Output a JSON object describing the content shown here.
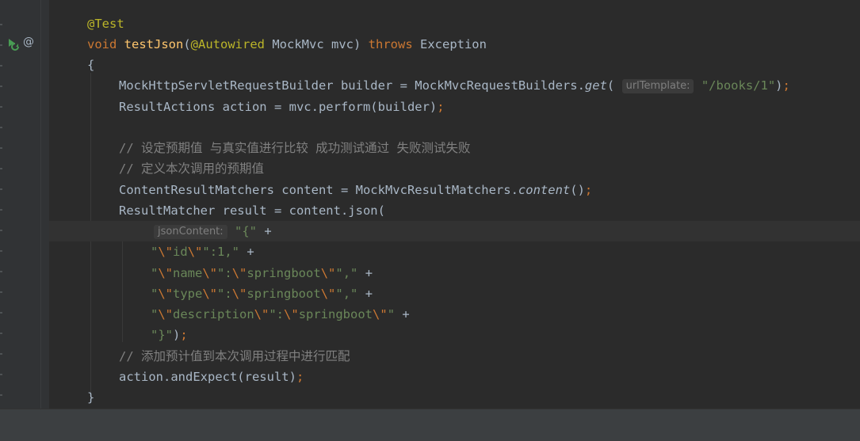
{
  "editor": {
    "code_lines": [
      {
        "id": "l1",
        "parts": [
          {
            "t": "@Test",
            "c": "ann"
          }
        ]
      },
      {
        "id": "l2",
        "parts": [
          {
            "t": "void ",
            "c": "kw"
          },
          {
            "t": "testJson",
            "c": "fn"
          },
          {
            "t": "(",
            "c": ""
          },
          {
            "t": "@Autowired",
            "c": "ann"
          },
          {
            "t": " MockMvc mvc) ",
            "c": ""
          },
          {
            "t": "throws",
            "c": "kw"
          },
          {
            "t": " Exception",
            "c": ""
          }
        ]
      },
      {
        "id": "l3",
        "parts": [
          {
            "t": "{",
            "c": ""
          }
        ]
      },
      {
        "id": "l4",
        "parts": [
          {
            "t": "MockHttpServletRequestBuilder builder = MockMvcRequestBuilders.",
            "c": ""
          },
          {
            "t": "get",
            "c": "it"
          },
          {
            "t": "( ",
            "c": ""
          },
          {
            "t": "urlTemplate:",
            "c": "hint"
          },
          {
            "t": " ",
            "c": ""
          },
          {
            "t": "\"/books/1\"",
            "c": "str"
          },
          {
            "t": ")",
            "c": ""
          },
          {
            "t": ";",
            "c": "kw"
          }
        ]
      },
      {
        "id": "l5",
        "parts": [
          {
            "t": "ResultActions action = mvc.perform(builder)",
            "c": ""
          },
          {
            "t": ";",
            "c": "kw"
          }
        ]
      },
      {
        "id": "l6",
        "parts": []
      },
      {
        "id": "l7",
        "parts": [
          {
            "t": "// 设定预期值 与真实值进行比较 成功测试通过 失败测试失败",
            "c": "cmt"
          }
        ]
      },
      {
        "id": "l8",
        "parts": [
          {
            "t": "// 定义本次调用的预期值",
            "c": "cmt"
          }
        ]
      },
      {
        "id": "l9",
        "parts": [
          {
            "t": "ContentResultMatchers content = MockMvcResultMatchers.",
            "c": ""
          },
          {
            "t": "content",
            "c": "it"
          },
          {
            "t": "()",
            "c": ""
          },
          {
            "t": ";",
            "c": "kw"
          }
        ]
      },
      {
        "id": "l10",
        "parts": [
          {
            "t": "ResultMatcher result = content.json(",
            "c": ""
          }
        ]
      },
      {
        "id": "l11",
        "parts": [
          {
            "t": "jsonContent:",
            "c": "hint"
          },
          {
            "t": " ",
            "c": ""
          },
          {
            "t": "\"{\"",
            "c": "str"
          },
          {
            "t": " +",
            "c": ""
          }
        ]
      },
      {
        "id": "l12",
        "parts": [
          {
            "t": "\"",
            "c": "str"
          },
          {
            "t": "\\\"",
            "c": "esc"
          },
          {
            "t": "id",
            "c": "str"
          },
          {
            "t": "\\\"",
            "c": "esc"
          },
          {
            "t": "\":1,\"",
            "c": "str"
          },
          {
            "t": " +",
            "c": ""
          }
        ]
      },
      {
        "id": "l13",
        "parts": [
          {
            "t": "\"",
            "c": "str"
          },
          {
            "t": "\\\"",
            "c": "esc"
          },
          {
            "t": "name",
            "c": "str"
          },
          {
            "t": "\\\"",
            "c": "esc"
          },
          {
            "t": "\":",
            "c": "str"
          },
          {
            "t": "\\\"",
            "c": "esc"
          },
          {
            "t": "springboot",
            "c": "str"
          },
          {
            "t": "\\\"",
            "c": "esc"
          },
          {
            "t": "\",\"",
            "c": "str"
          },
          {
            "t": " +",
            "c": ""
          }
        ]
      },
      {
        "id": "l14",
        "parts": [
          {
            "t": "\"",
            "c": "str"
          },
          {
            "t": "\\\"",
            "c": "esc"
          },
          {
            "t": "type",
            "c": "str"
          },
          {
            "t": "\\\"",
            "c": "esc"
          },
          {
            "t": "\":",
            "c": "str"
          },
          {
            "t": "\\\"",
            "c": "esc"
          },
          {
            "t": "springboot",
            "c": "str"
          },
          {
            "t": "\\\"",
            "c": "esc"
          },
          {
            "t": "\",\"",
            "c": "str"
          },
          {
            "t": " +",
            "c": ""
          }
        ]
      },
      {
        "id": "l15",
        "parts": [
          {
            "t": "\"",
            "c": "str"
          },
          {
            "t": "\\\"",
            "c": "esc"
          },
          {
            "t": "description",
            "c": "str"
          },
          {
            "t": "\\\"",
            "c": "esc"
          },
          {
            "t": "\":",
            "c": "str"
          },
          {
            "t": "\\\"",
            "c": "esc"
          },
          {
            "t": "springboot",
            "c": "str"
          },
          {
            "t": "\\\"",
            "c": "esc"
          },
          {
            "t": "\"",
            "c": "str"
          },
          {
            "t": " +",
            "c": ""
          }
        ]
      },
      {
        "id": "l16",
        "parts": [
          {
            "t": "\"}\"",
            "c": "str"
          },
          {
            "t": ")",
            "c": ""
          },
          {
            "t": ";",
            "c": "kw"
          }
        ]
      },
      {
        "id": "l17",
        "parts": [
          {
            "t": "// 添加预计值到本次调用过程中进行匹配",
            "c": "cmt"
          }
        ]
      },
      {
        "id": "l18",
        "parts": [
          {
            "t": "action.andExpect(result)",
            "c": ""
          },
          {
            "t": ";",
            "c": "kw"
          }
        ]
      },
      {
        "id": "l19",
        "parts": [
          {
            "t": "}",
            "c": ""
          }
        ]
      }
    ]
  },
  "gutter": {
    "run_icon": "run-test-icon",
    "reference_marker": "@"
  },
  "colors": {
    "background": "#2b2b2b",
    "gutter": "#313335",
    "keyword": "#cc7832",
    "annotation": "#bbb529",
    "function": "#ffc66d",
    "string": "#6a8759",
    "comment": "#808080",
    "text": "#a9b7c6"
  }
}
